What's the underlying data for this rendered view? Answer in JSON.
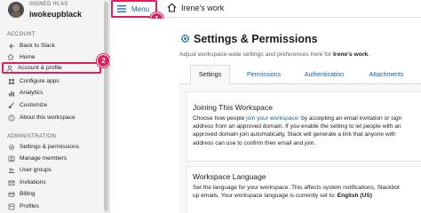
{
  "sidebar": {
    "signed_in_label": "SIGNED IN AS",
    "username": "iwokeupblack",
    "account_heading": "ACCOUNT",
    "admin_heading": "ADMINISTRATION",
    "account_items": [
      {
        "label": "Back to Slack",
        "icon": "arrow-left-icon"
      },
      {
        "label": "Home",
        "icon": "home-icon"
      },
      {
        "label": "Account & profile",
        "icon": "user-icon"
      },
      {
        "label": "Configure apps",
        "icon": "apps-icon"
      },
      {
        "label": "Analytics",
        "icon": "analytics-icon"
      },
      {
        "label": "Customize",
        "icon": "brush-icon"
      },
      {
        "label": "About this workspace",
        "icon": "info-icon"
      }
    ],
    "admin_items": [
      {
        "label": "Settings & permissions",
        "icon": "gear-icon"
      },
      {
        "label": "Manage members",
        "icon": "members-icon"
      },
      {
        "label": "User groups",
        "icon": "group-icon"
      },
      {
        "label": "Invitations",
        "icon": "invitation-icon"
      },
      {
        "label": "Billing",
        "icon": "billing-icon"
      },
      {
        "label": "Profiles",
        "icon": "profile-icon"
      }
    ]
  },
  "topbar": {
    "menu_label": "Menu",
    "workspace_title": "Irene's work"
  },
  "callouts": {
    "one": "1",
    "two": "2",
    "color": "#e01e5a"
  },
  "main": {
    "title": "Settings & Permissions",
    "subtitle_prefix": "Adjust workspace-wide settings and preferences here for ",
    "subtitle_workspace": "Irene's work",
    "subtitle_suffix": ".",
    "tabs": [
      "Settings",
      "Permissions",
      "Authentication",
      "Attachments"
    ],
    "active_tab": "Settings",
    "sections": [
      {
        "title": "Joining This Workspace",
        "text_1": "Choose how people ",
        "link": "join your workspace",
        "text_2": ": by accepting an email invitation or sign",
        "text_3": "address from an approved domain. If you enable the setting to let people with an",
        "text_4": "approved domain join automatically, Slack will generate a link that anyone with",
        "text_5": "address can use to confirm their email and join."
      },
      {
        "title": "Workspace Language",
        "text_1": "Set the language for your workspace. This affects system notifications, Slackbot",
        "text_2": "up emails. Your workspace language is currently set to: ",
        "value": "English (US)"
      }
    ]
  },
  "colors": {
    "accent": "#e01e5a",
    "link": "#1264a3",
    "sidebar_bg": "#f4f4f4"
  }
}
